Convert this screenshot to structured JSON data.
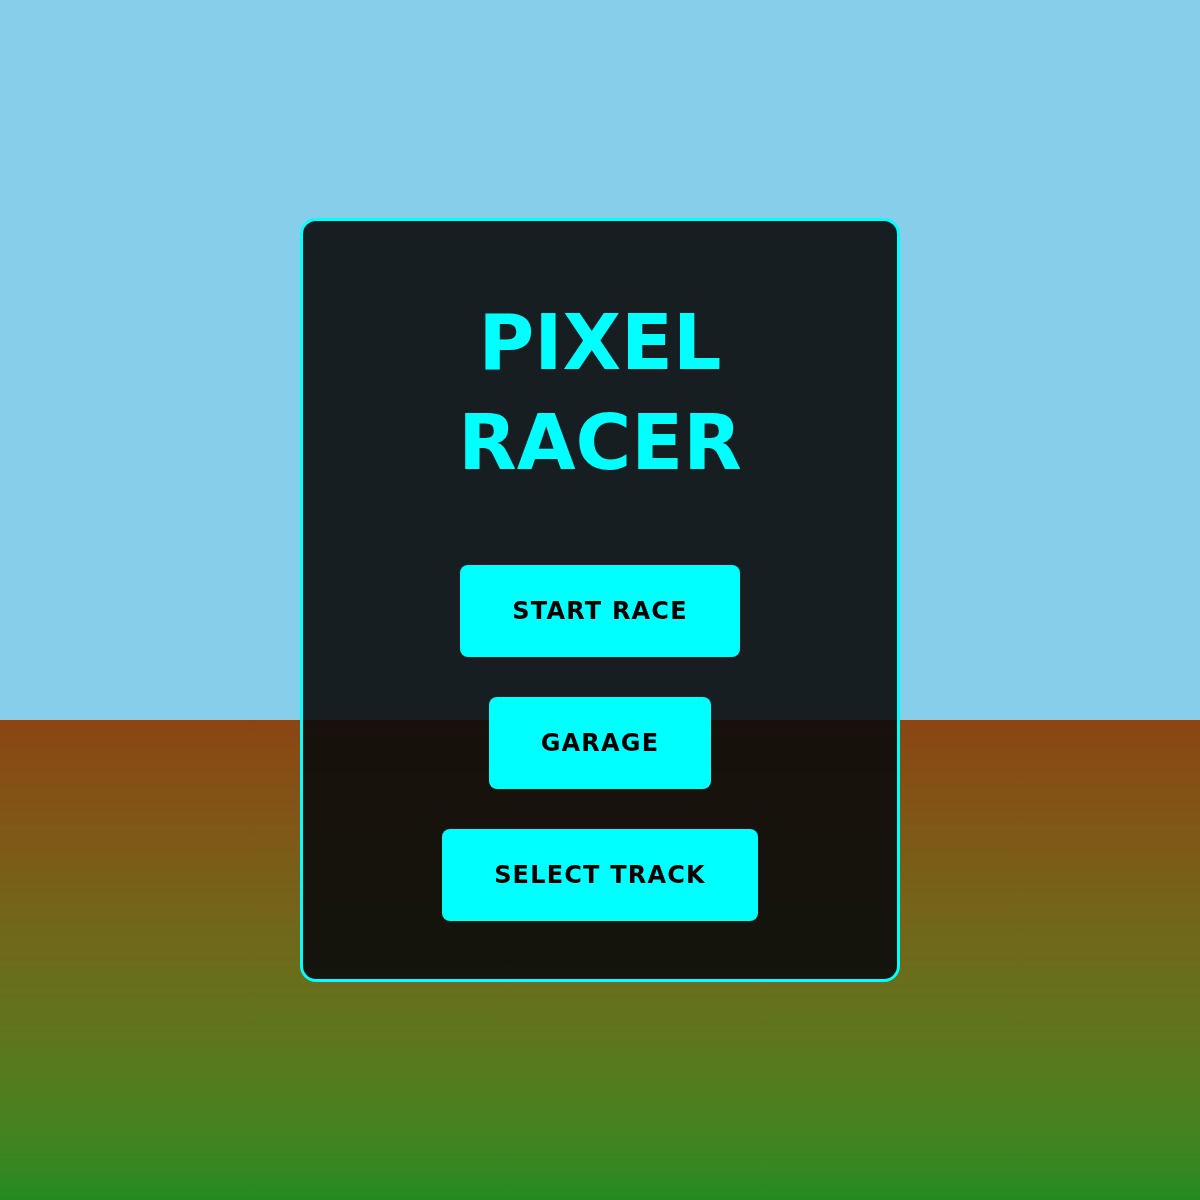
{
  "title": "PIXEL RACER",
  "menu_buttons": [
    "START RACE",
    "GARAGE",
    "SELECT TRACK"
  ]
}
